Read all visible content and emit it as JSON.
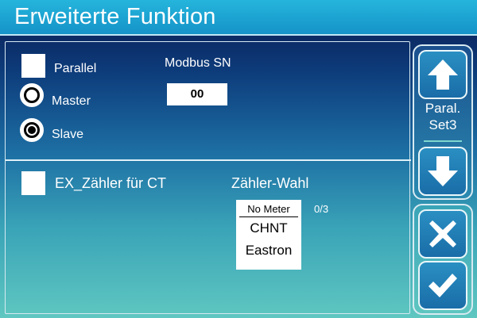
{
  "header": {
    "title": "Erweiterte Funktion"
  },
  "parallel": {
    "checkbox_label": "Parallel",
    "checked": false,
    "options": [
      {
        "label": "Master",
        "selected": false
      },
      {
        "label": "Slave",
        "selected": true
      }
    ]
  },
  "modbus": {
    "label": "Modbus SN",
    "value": "00"
  },
  "meter": {
    "checkbox_label": "EX_Zähler für CT",
    "checked": false,
    "select_label": "Zähler-Wahl",
    "options": [
      "No Meter",
      "CHNT",
      "Eastron"
    ],
    "selected": "No Meter",
    "counter": "0/3"
  },
  "side_panel": {
    "page_label_line1": "Paral.",
    "page_label_line2": "Set3",
    "buttons": [
      "up",
      "down",
      "cancel",
      "confirm"
    ]
  },
  "colors": {
    "title_bar": "#1fa6d6",
    "button_fill": "#1f7bb6",
    "accent_line": "#7fd7cf"
  }
}
